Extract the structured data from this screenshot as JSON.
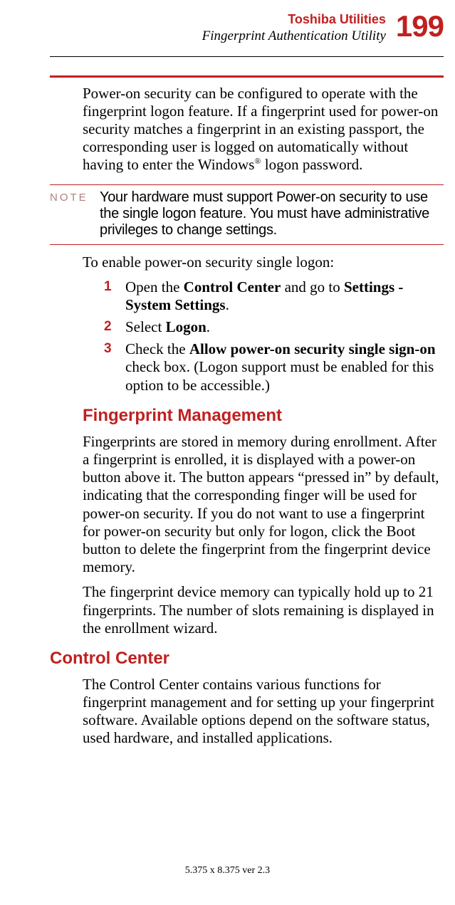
{
  "header": {
    "title": "Toshiba Utilities",
    "subtitle": "Fingerprint Authentication Utility",
    "page_number": "199"
  },
  "body": {
    "intro_1a": "Power-on security can be configured to operate with the fingerprint logon feature. If a fingerprint used for power-on security matches a fingerprint in an existing passport, the corresponding user is logged on automatically without having to enter the Windows",
    "intro_1b_sup": "®",
    "intro_1c": " logon password.",
    "note_label": "NOTE",
    "note_text": "Your hardware must support Power-on security to use the single logon feature. You must have administrative privileges to change settings.",
    "enable_line": "To enable power-on security single logon:",
    "steps": [
      {
        "num": "1",
        "a": "Open the ",
        "b1": "Control Center",
        "c": " and go to ",
        "b2": "Settings - System Settings",
        "d": "."
      },
      {
        "num": "2",
        "a": "Select ",
        "b1": "Logon",
        "c": "",
        "b2": "",
        "d": "."
      },
      {
        "num": "3",
        "a": "Check the ",
        "b1": "Allow power-on security single sign-on",
        "c": " check box. (Logon support must be enabled for this option to be accessible.)",
        "b2": "",
        "d": ""
      }
    ],
    "heading_fm": "Fingerprint Management",
    "fm_para1": "Fingerprints are stored in memory during enrollment. After a fingerprint is enrolled, it is displayed with a power-on button above it. The button appears “pressed in” by default, indicating that the corresponding finger will be used for power-on security. If you do not want to use a fingerprint for power-on security but only for logon, click the Boot button to delete the fingerprint from the fingerprint device memory.",
    "fm_para2": "The fingerprint device memory can typically hold up to 21 fingerprints. The number of slots remaining is displayed in the enrollment wizard.",
    "heading_cc": "Control Center",
    "cc_para": "The Control Center contains various functions for fingerprint management and for setting up your fingerprint software. Available options depend on the software status, used hardware, and installed applications."
  },
  "footer": "5.375 x 8.375 ver 2.3"
}
